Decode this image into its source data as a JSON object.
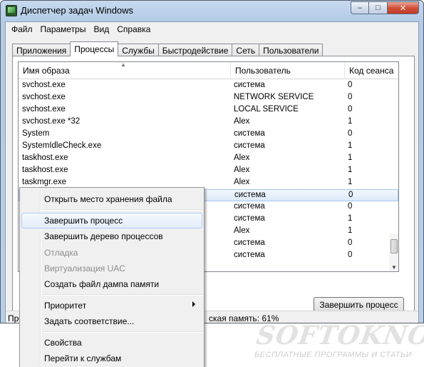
{
  "window": {
    "title": "Диспетчер задач Windows",
    "minimize": "–",
    "maximize": "□",
    "close": "✕"
  },
  "menu": [
    "Файл",
    "Параметры",
    "Вид",
    "Справка"
  ],
  "tabs": [
    "Приложения",
    "Процессы",
    "Службы",
    "Быстродействие",
    "Сеть",
    "Пользователи"
  ],
  "active_tab": "Процессы",
  "list": {
    "columns": [
      "Имя образа",
      "Пользователь",
      "Код сеанса"
    ],
    "rows": [
      {
        "name": "svchost.exe",
        "user": "система",
        "session": "0"
      },
      {
        "name": "svchost.exe",
        "user": "NETWORK SERVICE",
        "session": "0"
      },
      {
        "name": "svchost.exe",
        "user": "LOCAL SERVICE",
        "session": "0"
      },
      {
        "name": "svchost.exe *32",
        "user": "Alex",
        "session": "1"
      },
      {
        "name": "System",
        "user": "система",
        "session": "0"
      },
      {
        "name": "SystemIdleCheck.exe",
        "user": "система",
        "session": "1"
      },
      {
        "name": "taskhost.exe",
        "user": "Alex",
        "session": "1"
      },
      {
        "name": "taskhost.exe",
        "user": "Alex",
        "session": "1"
      },
      {
        "name": "taskmgr.exe",
        "user": "Alex",
        "session": "1"
      },
      {
        "name": "",
        "user": "система",
        "session": "0"
      },
      {
        "name": "",
        "user": "система",
        "session": "0"
      },
      {
        "name": "",
        "user": "система",
        "session": "1"
      },
      {
        "name": "",
        "user": "Alex",
        "session": "1"
      },
      {
        "name": "",
        "user": "система",
        "session": "0"
      },
      {
        "name": "",
        "user": "система",
        "session": "0"
      }
    ],
    "selected_row": 9
  },
  "end_process_button": "Завершить процесс",
  "status": {
    "left": "Про",
    "memory": "ская память: 61%"
  },
  "context_menu": {
    "items": [
      {
        "label": "Открыть место хранения файла",
        "disabled": false
      },
      {
        "label": "Завершить процесс",
        "disabled": false,
        "hover": true
      },
      {
        "label": "Завершить дерево процессов",
        "disabled": false
      },
      {
        "label": "Отладка",
        "disabled": true
      },
      {
        "label": "Виртуализация UAC",
        "disabled": true
      },
      {
        "label": "Создать файл дампа памяти",
        "disabled": false
      },
      {
        "label": "Приоритет",
        "disabled": false,
        "submenu": true
      },
      {
        "label": "Задать соответствие...",
        "disabled": false
      },
      {
        "label": "Свойства",
        "disabled": false
      },
      {
        "label": "Перейти к службам",
        "disabled": false
      }
    ]
  },
  "watermark": {
    "title": "SOFTOKNO.RU",
    "subtitle": "БЕСПЛАТНЫЕ ПРОГРАММЫ И СТАТЬИ"
  }
}
